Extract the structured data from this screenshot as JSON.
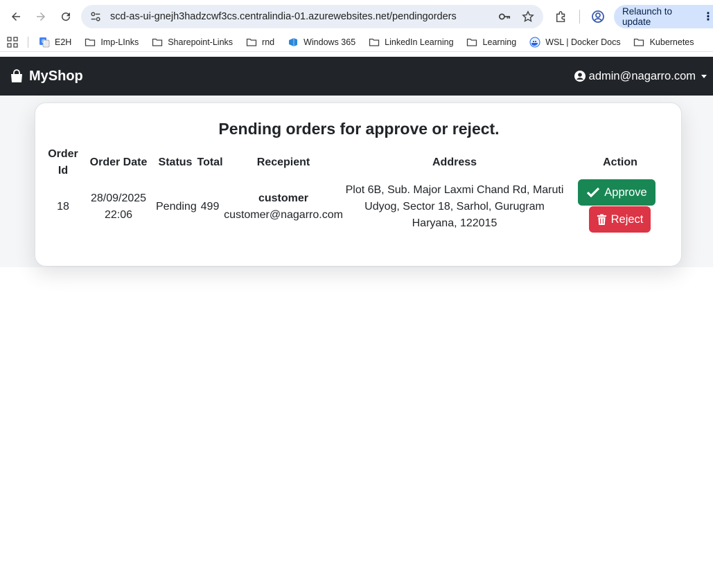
{
  "browser": {
    "url": "scd-as-ui-gnejh3hadzcwf3cs.centralindia-01.azurewebsites.net/pendingorders",
    "relaunch_label": "Relaunch to update",
    "bookmarks": [
      "E2H",
      "Imp-LInks",
      "Sharepoint-Links",
      "rnd",
      "Windows 365",
      "LinkedIn Learning",
      "Learning",
      "WSL | Docker Docs",
      "Kubernetes"
    ]
  },
  "navbar": {
    "brand": "MyShop",
    "user": "admin@nagarro.com"
  },
  "page": {
    "title": "Pending orders for approve or reject."
  },
  "table": {
    "headers": {
      "order_id_1": "Order",
      "order_id_2": "Id",
      "order_date": "Order Date",
      "status": "Status",
      "total": "Total",
      "recipient": "Recepient",
      "address": "Address",
      "action": "Action"
    },
    "rows": [
      {
        "order_id": "18",
        "date_1": "28/09/2025",
        "date_2": "22:06",
        "status": "Pending",
        "total": "499",
        "recipient_name": "customer",
        "recipient_email": "customer@nagarro.com",
        "address_1": "Plot 6B, Sub. Major Laxmi Chand Rd, Maruti",
        "address_2": "Udyog, Sector 18, Sarhol, Gurugram",
        "address_3": "Haryana, 122015",
        "approve_label": "Approve",
        "reject_label": "Reject"
      }
    ]
  },
  "colors": {
    "navbar": "#212529",
    "approve": "#198754",
    "reject": "#dc3545"
  }
}
